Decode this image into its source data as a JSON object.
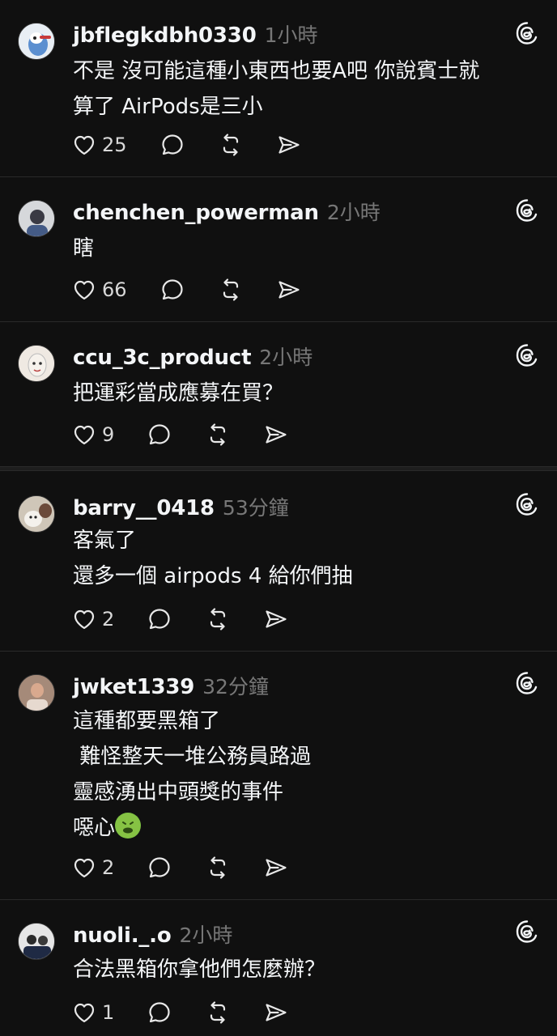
{
  "comments": [
    {
      "username": "jbflegkdbh0330",
      "time": "1小時",
      "lines": [
        "不是 沒可能這種小東西也要A吧 你說賓士就",
        "算了 AirPods是三小"
      ],
      "likes": "25"
    },
    {
      "username": "chenchen_powerman",
      "time": "2小時",
      "lines": [
        "瞎"
      ],
      "likes": "66"
    },
    {
      "username": "ccu_3c_product",
      "time": "2小時",
      "lines": [
        "把運彩當成應募在買？"
      ],
      "likes": "9"
    },
    {
      "username": "barry__0418",
      "time": "53分鐘",
      "lines": [
        "客氣了",
        "還多一個 airpods 4 給你們抽"
      ],
      "likes": "2"
    },
    {
      "username": "jwket1339",
      "time": "32分鐘",
      "lines": [
        "這種都要黑箱了",
        " 難怪整天一堆公務員路過",
        "靈感湧出中頭獎的事件",
        "噁心"
      ],
      "likes": "2"
    },
    {
      "username": "nuoli._.o",
      "time": "2小時",
      "lines": [
        "合法黑箱你拿他們怎麼辦？"
      ],
      "likes": "1"
    }
  ],
  "icons": {
    "like": "heart-icon",
    "reply": "comment-icon",
    "repost": "repost-icon",
    "share": "send-icon",
    "brand": "threads-logo-icon",
    "emoji": "nauseated-face-emoji"
  },
  "colors": {
    "background": "#101010",
    "text": "#f3f5f7",
    "muted": "#777777",
    "divider": "#2a2a2a"
  }
}
